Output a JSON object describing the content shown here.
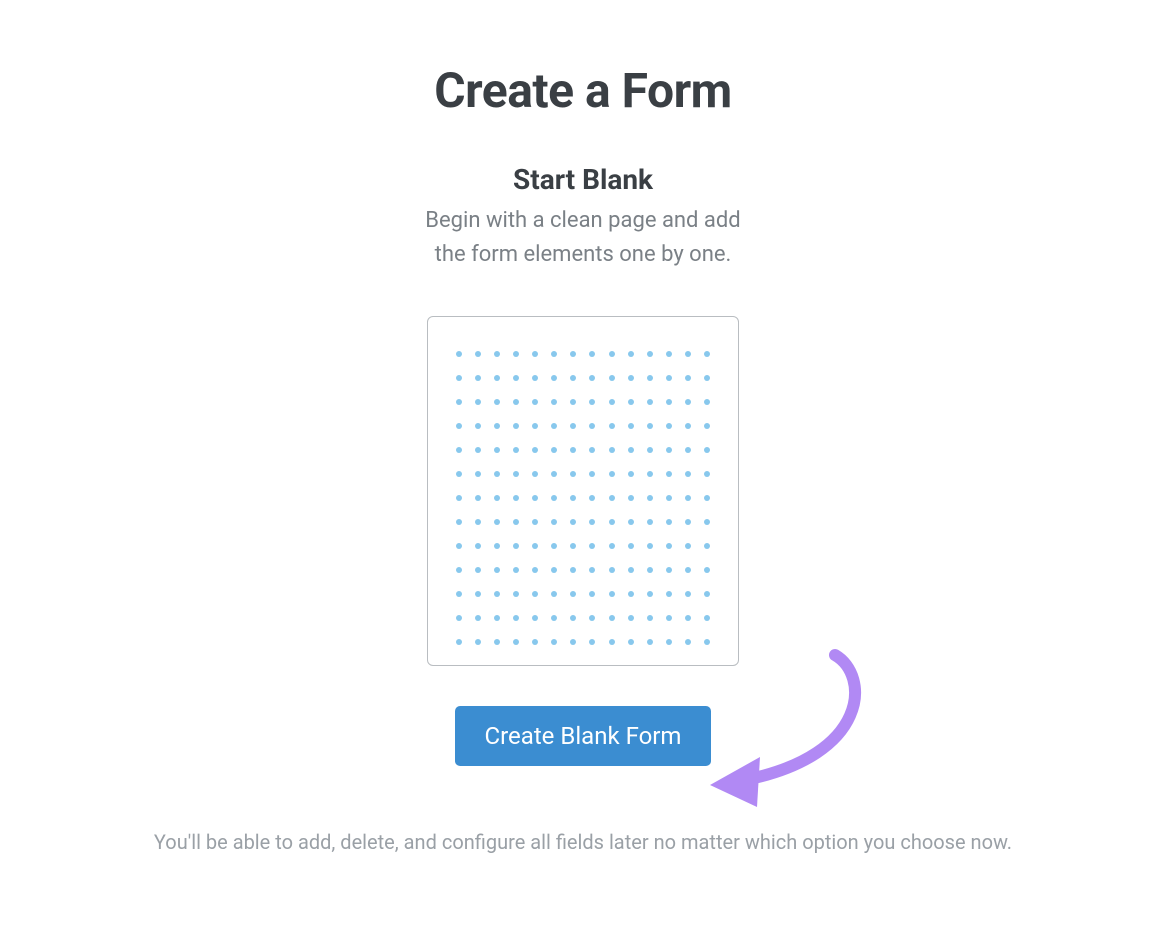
{
  "header": {
    "title": "Create a Form"
  },
  "section": {
    "title": "Start Blank",
    "description_line1": "Begin with a clean page and add",
    "description_line2": "the form elements one by one."
  },
  "action": {
    "create_button_label": "Create Blank Form"
  },
  "footer": {
    "note": "You'll be able to add, delete, and configure all fields later no matter which option you choose now."
  }
}
